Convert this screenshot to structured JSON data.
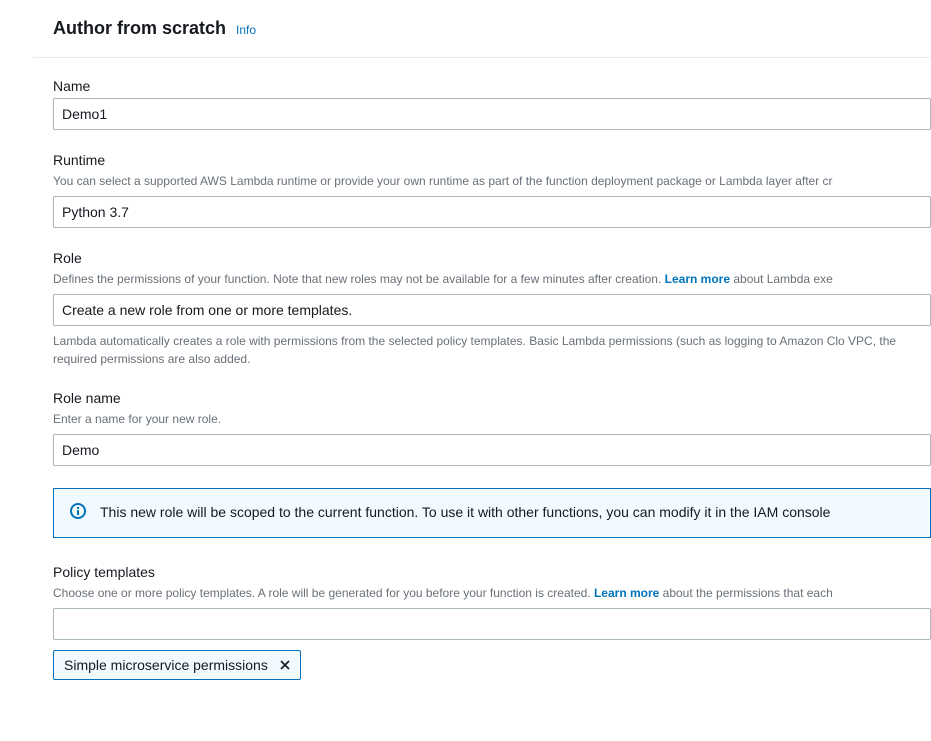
{
  "header": {
    "title": "Author from scratch",
    "info": "Info"
  },
  "name": {
    "label": "Name",
    "value": "Demo1"
  },
  "runtime": {
    "label": "Runtime",
    "hint": "You can select a supported AWS Lambda runtime or provide your own runtime as part of the function deployment package or Lambda layer after cr",
    "value": "Python 3.7"
  },
  "role": {
    "label": "Role",
    "hint_pre": "Defines the permissions of your function. Note that new roles may not be available for a few minutes after creation. ",
    "learn_more": "Learn more",
    "hint_post": " about Lambda exe",
    "value": "Create a new role from one or more templates.",
    "below": "Lambda automatically creates a role with permissions from the selected policy templates. Basic Lambda permissions (such as logging to Amazon Clo VPC, the required permissions are also added."
  },
  "role_name": {
    "label": "Role name",
    "hint": "Enter a name for your new role.",
    "value": "Demo"
  },
  "infobox": {
    "text": "This new role will be scoped to the current function. To use it with other functions, you can modify it in the IAM console"
  },
  "policy": {
    "label": "Policy templates",
    "hint_pre": "Choose one or more policy templates. A role will be generated for you before your function is created. ",
    "learn_more": "Learn more",
    "hint_post": " about the permissions that each",
    "value": "",
    "token": "Simple microservice permissions"
  }
}
